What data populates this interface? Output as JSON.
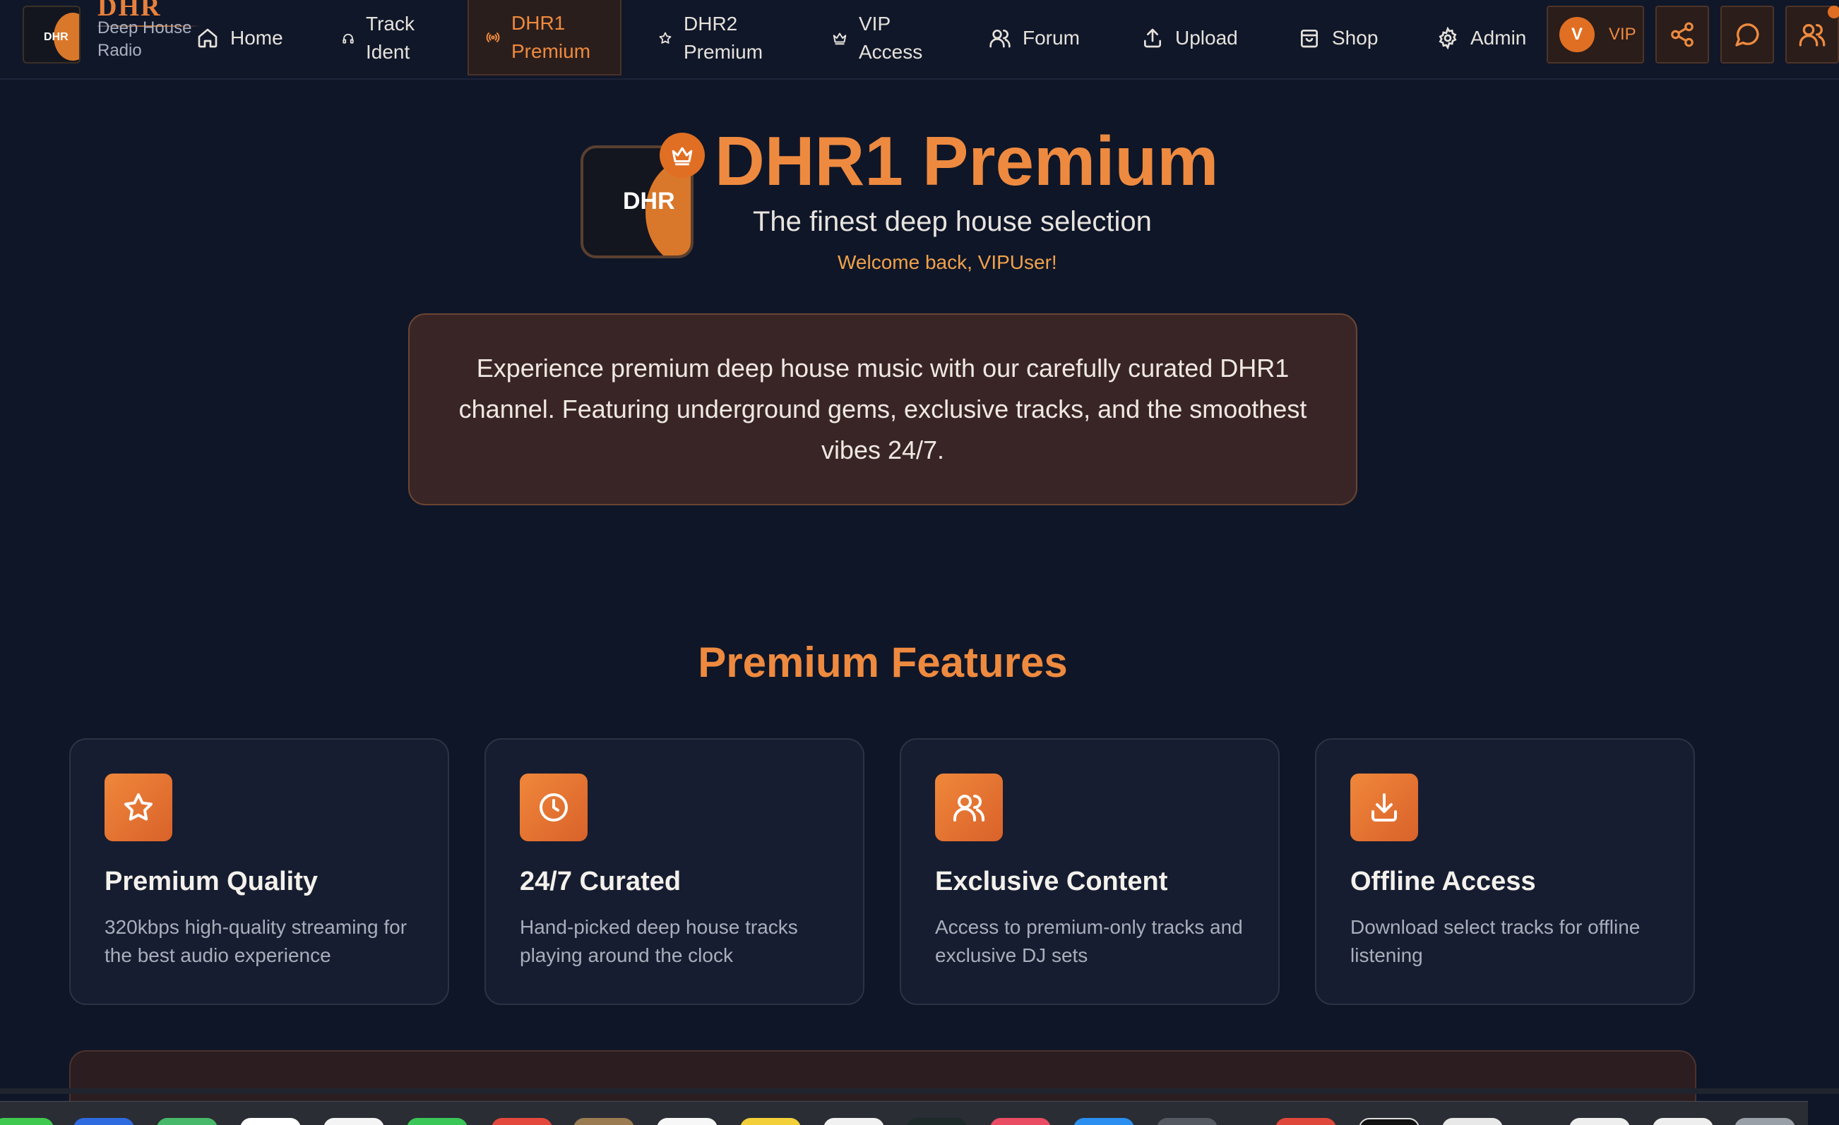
{
  "brand": {
    "logo_text": "DHR",
    "name": "DHR",
    "subtitle": "Deep House Radio"
  },
  "nav": {
    "items": [
      {
        "label": "Home",
        "icon": "home-icon"
      },
      {
        "label": "Track Ident",
        "icon": "headphones-icon"
      },
      {
        "label": "DHR1 Premium",
        "icon": "radio-icon",
        "active": true
      },
      {
        "label": "DHR2 Premium",
        "icon": "star-icon"
      },
      {
        "label": "VIP Access",
        "icon": "crown-icon"
      },
      {
        "label": "Forum",
        "icon": "users-icon"
      },
      {
        "label": "Upload",
        "icon": "upload-icon"
      },
      {
        "label": "Shop",
        "icon": "shopping-bag-icon"
      },
      {
        "label": "Admin",
        "icon": "gear-icon"
      }
    ],
    "user_initial": "V",
    "vip_label": "VIP"
  },
  "hero": {
    "logo_text": "DHR",
    "title": "DHR1 Premium",
    "subtitle": "The finest deep house selection",
    "welcome": "Welcome back, VIPUser!"
  },
  "description": "Experience premium deep house music with our carefully curated DHR1 channel. Featuring underground gems, exclusive tracks, and the smoothest vibes 24/7.",
  "features": {
    "heading": "Premium Features",
    "cards": [
      {
        "title": "Premium Quality",
        "desc": "320kbps high-quality streaming for the best audio experience",
        "icon": "star-icon"
      },
      {
        "title": "24/7 Curated",
        "desc": "Hand-picked deep house tracks playing around the clock",
        "icon": "clock-icon"
      },
      {
        "title": "Exclusive Content",
        "desc": "Access to premium-only tracks and exclusive DJ sets",
        "icon": "users-icon"
      },
      {
        "title": "Offline Access",
        "desc": "Download select tracks for offline listening",
        "icon": "download-icon"
      }
    ]
  },
  "colors": {
    "background": "#0f1628",
    "accent": "#ee8a3f",
    "card": "#161d30",
    "description_box": "#3a2526"
  }
}
